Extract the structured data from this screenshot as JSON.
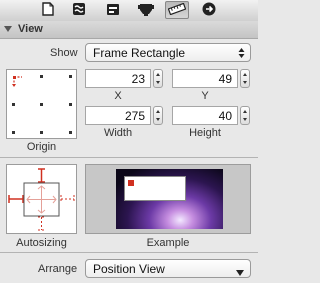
{
  "toolbar": {
    "tabs": [
      {
        "icon": "document-icon"
      },
      {
        "icon": "connections-icon"
      },
      {
        "icon": "attributes-icon"
      },
      {
        "icon": "plugin-icon"
      },
      {
        "icon": "ruler-icon"
      },
      {
        "icon": "arrow-right-circle-icon"
      }
    ],
    "active_tab": 4
  },
  "section": {
    "title": "View"
  },
  "show": {
    "label": "Show",
    "value": "Frame Rectangle"
  },
  "fields": {
    "x": {
      "value": "23",
      "caption": "X"
    },
    "y": {
      "value": "49",
      "caption": "Y"
    },
    "width": {
      "value": "275",
      "caption": "Width"
    },
    "height": {
      "value": "40",
      "caption": "Height"
    }
  },
  "origin": {
    "caption": "Origin"
  },
  "autosizing": {
    "caption": "Autosizing"
  },
  "example": {
    "caption": "Example"
  },
  "arrange": {
    "label": "Arrange",
    "value": "Position View"
  },
  "colors": {
    "accent_red": "#d03020",
    "toolbar_bg": "#d9d9d9",
    "panel_bg": "#e8e8e8"
  }
}
